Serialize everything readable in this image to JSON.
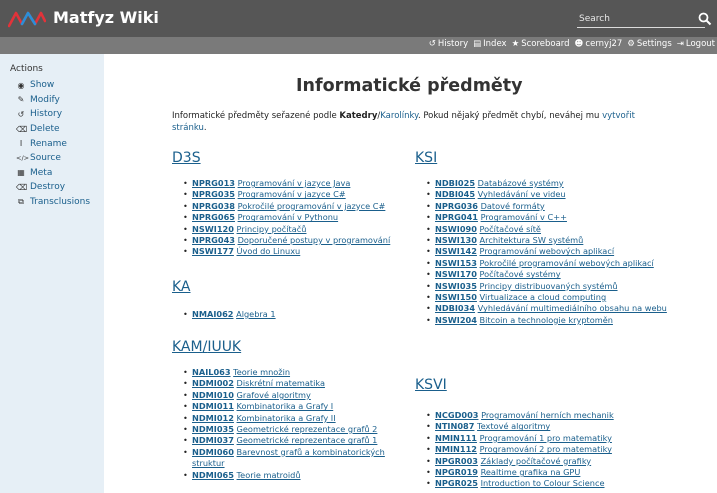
{
  "header": {
    "brand": "Matfyz Wiki",
    "search_placeholder": "Search",
    "colors": {
      "topbar": "#565656",
      "subbar": "#7a7a7a",
      "logo_red": "#e2333a",
      "logo_blue": "#2a8fd8",
      "link": "#1a5f8c",
      "sidebar_bg": "#e6eff6"
    }
  },
  "usernav": [
    {
      "icon": "history-icon",
      "glyph": "↺",
      "label": "History"
    },
    {
      "icon": "index-icon",
      "glyph": "▤",
      "label": "Index"
    },
    {
      "icon": "star-icon",
      "glyph": "★",
      "label": "Scoreboard"
    },
    {
      "icon": "user-icon",
      "glyph": "👤",
      "label": "cernyj27"
    },
    {
      "icon": "gear-icon",
      "glyph": "⚙",
      "label": "Settings"
    },
    {
      "icon": "logout-icon",
      "glyph": "⇥",
      "label": "Logout"
    }
  ],
  "sidebar": {
    "title": "Actions",
    "items": [
      {
        "icon": "eye-icon",
        "glyph": "◉",
        "label": "Show"
      },
      {
        "icon": "pencil-icon",
        "glyph": "✎",
        "label": "Modify"
      },
      {
        "icon": "history-icon",
        "glyph": "↺",
        "label": "History"
      },
      {
        "icon": "trash-icon",
        "glyph": "🗑",
        "label": "Delete"
      },
      {
        "icon": "cursor-icon",
        "glyph": "I",
        "label": "Rename"
      },
      {
        "icon": "code-icon",
        "glyph": "</>",
        "label": "Source"
      },
      {
        "icon": "table-icon",
        "glyph": "▦",
        "label": "Meta"
      },
      {
        "icon": "eraser-icon",
        "glyph": "⌫",
        "label": "Destroy"
      },
      {
        "icon": "transclusion-icon",
        "glyph": "⧉",
        "label": "Transclusions"
      }
    ]
  },
  "main": {
    "title": "Informatické předměty",
    "intro_before": "Informatické předměty seřazené podle ",
    "intro_bold": "Katedry",
    "intro_slash": "/",
    "intro_link1": "Karolínky",
    "intro_mid": ". Pokud nějaký předmět chybí, neváhej mu ",
    "intro_link2": "vytvořit stránku",
    "intro_end": ".",
    "sections": {
      "d3s": {
        "title": "D3S",
        "courses": [
          {
            "code": "NPRG013",
            "name": "Programování v jazyce Java"
          },
          {
            "code": "NPRG035",
            "name": "Programování v jazyce C#"
          },
          {
            "code": "NPRG038",
            "name": "Pokročilé programování v jazyce C#"
          },
          {
            "code": "NPRG065",
            "name": "Programování v Pythonu"
          },
          {
            "code": "NSWI120",
            "name": "Principy počítačů"
          },
          {
            "code": "NPRG043",
            "name": "Doporučené postupy v programování"
          },
          {
            "code": "NSWI177",
            "name": "Úvod do Linuxu"
          }
        ]
      },
      "ka": {
        "title": "KA",
        "courses": [
          {
            "code": "NMAI062",
            "name": "Algebra 1"
          }
        ]
      },
      "kam": {
        "title_a": "KAM",
        "title_sep": "/",
        "title_b": "IUUK",
        "courses": [
          {
            "code": "NAIL063",
            "name": "Teorie množin"
          },
          {
            "code": "NDMI002",
            "name": "Diskrétní matematika"
          },
          {
            "code": "NDMI010",
            "name": "Grafové algoritmy"
          },
          {
            "code": "NDMI011",
            "name": "Kombinatorika a Grafy I"
          },
          {
            "code": "NDMI012",
            "name": "Kombinatorika a Grafy II"
          },
          {
            "code": "NDMI035",
            "name": "Geometrické reprezentace grafů 2"
          },
          {
            "code": "NDMI037",
            "name": "Geometrické reprezentace grafů 1"
          },
          {
            "code": "NDMI060",
            "name": "Barevnost grafů a kombinatorických struktur"
          },
          {
            "code": "NDMI065",
            "name": "Teorie matroidů"
          }
        ]
      },
      "ksi": {
        "title": "KSI",
        "courses": [
          {
            "code": "NDBI025",
            "name": "Databázové systémy"
          },
          {
            "code": "NDBI045",
            "name": "Vyhledávání ve videu"
          },
          {
            "code": "NPRG036",
            "name": "Datové formáty"
          },
          {
            "code": "NPRG041",
            "name": "Programování v C++"
          },
          {
            "code": "NSWI090",
            "name": "Počítačové sítě"
          },
          {
            "code": "NSWI130",
            "name": "Architektura SW systémů"
          },
          {
            "code": "NSWI142",
            "name": "Programování webových aplikací"
          },
          {
            "code": "NSWI153",
            "name": "Pokročilé programování webových aplikací"
          },
          {
            "code": "NSWI170",
            "name": "Počítačové systémy"
          },
          {
            "code": "NSWI035",
            "name": "Principy distribuovaných systémů"
          },
          {
            "code": "NSWI150",
            "name": "Virtualizace a cloud computing"
          },
          {
            "code": "NDBI034",
            "name": "Vyhledávání multimediálního obsahu na webu"
          },
          {
            "code": "NSWI204",
            "name": "Bitcoin a technologie kryptoměn"
          }
        ]
      },
      "ksvi": {
        "title": "KSVI",
        "courses": [
          {
            "code": "NCGD003",
            "name": "Programování herních mechanik"
          },
          {
            "code": "NTIN087",
            "name": "Textové algoritmy"
          },
          {
            "code": "NMIN111",
            "name": "Programování 1 pro matematiky"
          },
          {
            "code": "NMIN112",
            "name": "Programování 2 pro matematiky"
          },
          {
            "code": "NPGR003",
            "name": "Základy počítačové grafiky"
          },
          {
            "code": "NPGR019",
            "name": "Realtime grafika na GPU"
          },
          {
            "code": "NPGR025",
            "name": "Introduction to Colour Science"
          }
        ]
      }
    }
  }
}
